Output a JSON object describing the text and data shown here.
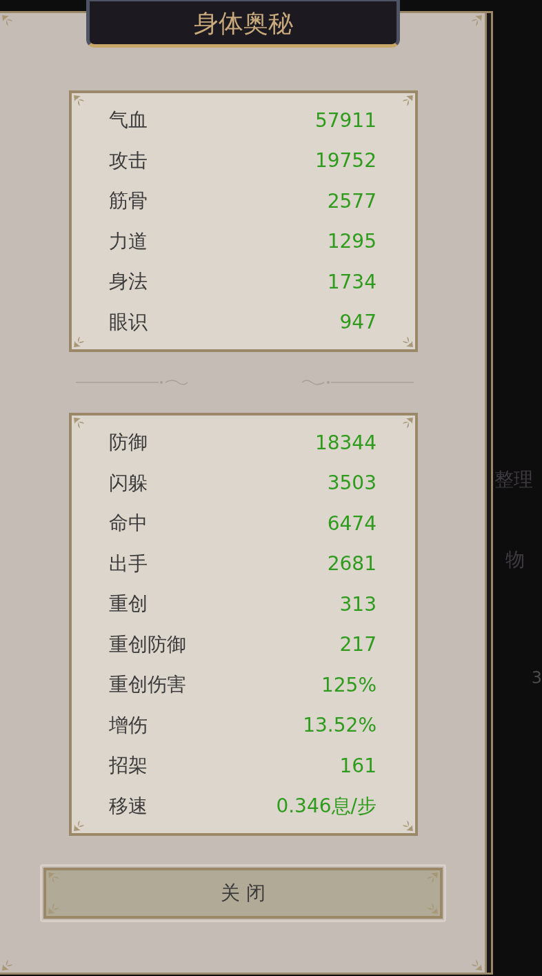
{
  "window": {
    "title": "身体奥秘"
  },
  "stat_groups": [
    {
      "stats": [
        {
          "label": "气血",
          "value": "57911"
        },
        {
          "label": "攻击",
          "value": "19752"
        },
        {
          "label": "筋骨",
          "value": "2577"
        },
        {
          "label": "力道",
          "value": "1295"
        },
        {
          "label": "身法",
          "value": "1734"
        },
        {
          "label": "眼识",
          "value": "947"
        }
      ]
    },
    {
      "stats": [
        {
          "label": "防御",
          "value": "18344"
        },
        {
          "label": "闪躲",
          "value": "3503"
        },
        {
          "label": "命中",
          "value": "6474"
        },
        {
          "label": "出手",
          "value": "2681"
        },
        {
          "label": "重创",
          "value": "313"
        },
        {
          "label": "重创防御",
          "value": "217"
        },
        {
          "label": "重创伤害",
          "value": "125%"
        },
        {
          "label": "增伤",
          "value": "13.52%"
        },
        {
          "label": "招架",
          "value": "161"
        },
        {
          "label": "移速",
          "value": "0.346息/步"
        }
      ]
    }
  ],
  "close_button": "关 闭",
  "background": {
    "tab_1": "整理",
    "tab_2": "物",
    "count": "3"
  }
}
